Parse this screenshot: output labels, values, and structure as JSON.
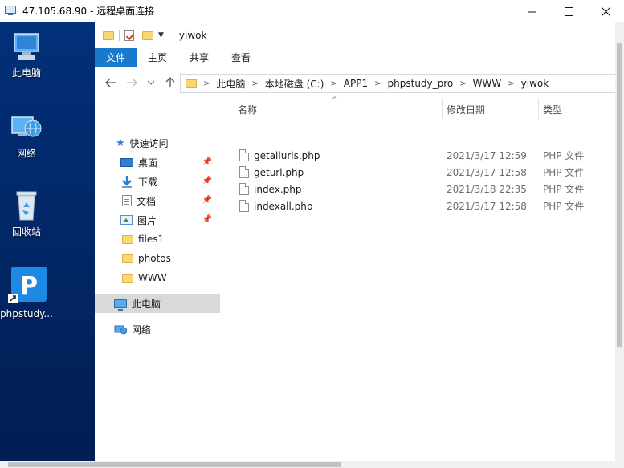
{
  "window": {
    "title": "47.105.68.90 - 远程桌面连接",
    "controls": {
      "minimize_icon": "minimize-icon",
      "maximize_icon": "maximize-icon",
      "close_icon": "close-icon"
    }
  },
  "desktop": {
    "icons": [
      {
        "label": "此电脑",
        "icon": "computer-icon"
      },
      {
        "label": "网络",
        "icon": "network-icon"
      },
      {
        "label": "回收站",
        "icon": "recycle-bin-icon"
      },
      {
        "label": "phpstudy...",
        "icon": "phpstudy-icon"
      }
    ]
  },
  "explorer": {
    "quick_access_title": "yiwok",
    "ribbon_tabs": [
      "文件",
      "主页",
      "共享",
      "查看"
    ],
    "address": {
      "crumbs": [
        "此电脑",
        "本地磁盘 (C:)",
        "APP1",
        "phpstudy_pro",
        "WWW",
        "yiwok"
      ]
    },
    "nav": {
      "quick_access": "快速访问",
      "items": [
        {
          "label": "桌面",
          "icon": "desktop-icon",
          "pinned": true
        },
        {
          "label": "下载",
          "icon": "download-icon",
          "pinned": true
        },
        {
          "label": "文档",
          "icon": "document-icon",
          "pinned": true
        },
        {
          "label": "图片",
          "icon": "picture-icon",
          "pinned": true
        },
        {
          "label": "files1",
          "icon": "folder-icon",
          "pinned": false
        },
        {
          "label": "photos",
          "icon": "folder-icon",
          "pinned": false
        },
        {
          "label": "WWW",
          "icon": "folder-icon",
          "pinned": false
        }
      ],
      "this_pc": "此电脑",
      "network": "网络"
    },
    "columns": {
      "name": "名称",
      "date": "修改日期",
      "type": "类型"
    },
    "files": [
      {
        "name": "getallurls.php",
        "date": "2021/3/17 12:59",
        "type": "PHP 文件"
      },
      {
        "name": "geturl.php",
        "date": "2021/3/17 12:58",
        "type": "PHP 文件"
      },
      {
        "name": "index.php",
        "date": "2021/3/18 22:35",
        "type": "PHP 文件"
      },
      {
        "name": "indexall.php",
        "date": "2021/3/17 12:58",
        "type": "PHP 文件"
      }
    ]
  },
  "colors": {
    "file_tab": "#1979ca",
    "desktop_bg": "#02307a",
    "selected_nav": "#d9d9d9"
  }
}
